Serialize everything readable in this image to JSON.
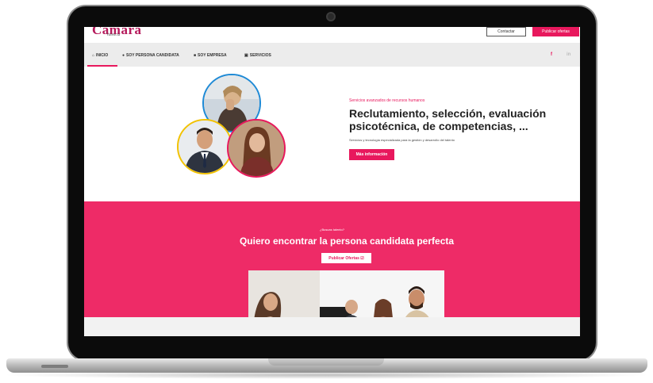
{
  "header": {
    "logo_text": "Camara",
    "logo_sub": "Valencia",
    "contact_label": "Contactar",
    "publish_label": "Publicar ofertas"
  },
  "nav": {
    "items": [
      {
        "label": "INICIO",
        "icon": "home-icon"
      },
      {
        "label": "SOY PERSONA CANDIDATA",
        "icon": "user-icon"
      },
      {
        "label": "SOY EMPRESA",
        "icon": "building-icon"
      },
      {
        "label": "SERVICIOS",
        "icon": "briefcase-icon"
      }
    ],
    "social": [
      "f",
      "in"
    ]
  },
  "hero": {
    "eyebrow": "Servicios avanzados de recursos humanos",
    "title": "Reclutamiento, selección, evaluación psicotécnica, de competencias, ...",
    "description": "Servicios y tecnología especializada para la gestión y desarrollo del talento",
    "button_label": "Más información"
  },
  "band": {
    "eyebrow": "¿Buscas talento?",
    "title": "Quiero encontrar la persona candidata perfecta",
    "button_label": "Publicar Ofertas ☑"
  },
  "colors": {
    "accent": "#e8185d",
    "band": "#ee2b67"
  }
}
